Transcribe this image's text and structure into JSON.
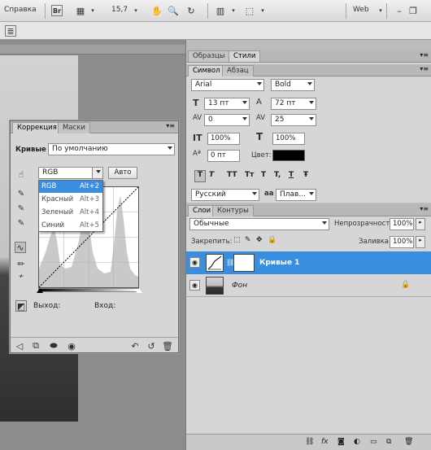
{
  "appbar": {
    "help_label": "Справка",
    "zoom_value": "15,7",
    "workspace": "Web"
  },
  "adjustments": {
    "tabs": [
      "Коррекция",
      "Маски"
    ],
    "curves_label": "Кривые",
    "preset_value": "По умолчанию",
    "channel_value": "RGB",
    "auto_label": "Авто",
    "channel_options": [
      {
        "label": "RGB",
        "shortcut": "Alt+2"
      },
      {
        "label": "Красный",
        "shortcut": "Alt+3"
      },
      {
        "label": "Зеленый",
        "shortcut": "Alt+4"
      },
      {
        "label": "Синий",
        "shortcut": "Alt+5"
      }
    ],
    "output_label": "Выход:",
    "input_label": "Вход:"
  },
  "top_panel": {
    "tabs": [
      "Образцы",
      "Стили"
    ]
  },
  "character": {
    "tabs": [
      "Символ",
      "Абзац"
    ],
    "font_family": "Arial",
    "font_style": "Bold",
    "font_size": "13 пт",
    "leading": "72 пт",
    "kerning": "0",
    "tracking": "25",
    "vertical_scale": "100%",
    "horizontal_scale": "100%",
    "baseline_shift": "0 пт",
    "color_label": "Цвет:",
    "color": "#000000",
    "style_buttons": [
      "T",
      "T",
      "TT",
      "Tт",
      "T",
      "T,",
      "T",
      "Ŧ"
    ],
    "language": "Русский",
    "antialias": "Плав..."
  },
  "layers": {
    "tabs": [
      "Слои",
      "Контуры"
    ],
    "blend_mode": "Обычные",
    "opacity_label": "Непрозрачность:",
    "opacity_value": "100%",
    "lock_label": "Закрепить:",
    "fill_label": "Заливка:",
    "fill_value": "100%",
    "items": [
      {
        "name": "Кривые 1",
        "selected": true
      },
      {
        "name": "Фон",
        "selected": false
      }
    ]
  },
  "colors": {
    "selection": "#3a8ee0",
    "panel_bg": "#d6d6d6"
  }
}
